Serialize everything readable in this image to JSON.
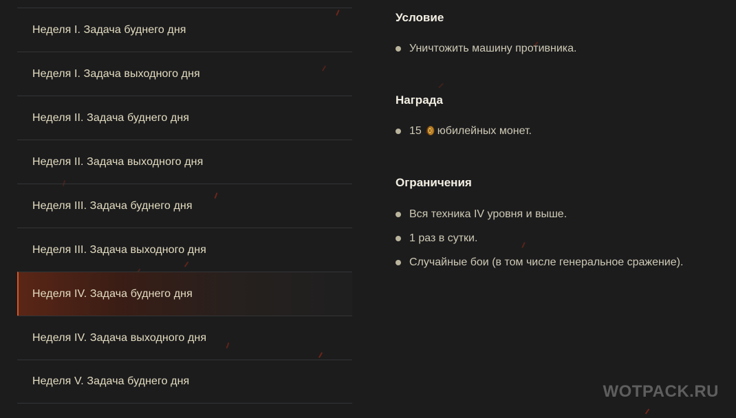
{
  "tasks": [
    {
      "label": "Неделя I. Задача буднего дня",
      "active": false
    },
    {
      "label": "Неделя I. Задача выходного дня",
      "active": false
    },
    {
      "label": "Неделя II. Задача буднего дня",
      "active": false
    },
    {
      "label": "Неделя II. Задача выходного дня",
      "active": false
    },
    {
      "label": "Неделя III. Задача буднего дня",
      "active": false
    },
    {
      "label": "Неделя III. Задача выходного дня",
      "active": false
    },
    {
      "label": "Неделя IV. Задача буднего дня",
      "active": true
    },
    {
      "label": "Неделя IV. Задача выходного дня",
      "active": false
    },
    {
      "label": "Неделя V. Задача буднего дня",
      "active": false
    }
  ],
  "condition": {
    "title": "Условие",
    "items": [
      "Уничтожить машину противника."
    ]
  },
  "reward": {
    "title": "Награда",
    "amount": "15",
    "icon": "coin-icon",
    "text": "юбилейных монет."
  },
  "restrictions": {
    "title": "Ограничения",
    "items": [
      "Вся техника IV уровня и выше.",
      "1 раз в сутки.",
      "Случайные бои (в том числе генеральное сражение)."
    ]
  },
  "watermark": "WOTPACK.RU",
  "colors": {
    "accent": "#d9562a",
    "background": "#1c1c1d"
  }
}
